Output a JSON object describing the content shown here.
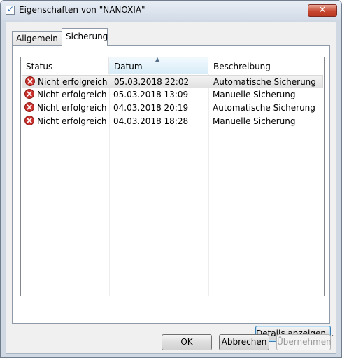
{
  "window": {
    "title": "Eigenschaften von \"NANOXIA\"",
    "close_label": "✕"
  },
  "tabs": [
    {
      "label": "Allgemein",
      "active": false
    },
    {
      "label": "Sicherung",
      "active": true
    }
  ],
  "list": {
    "columns": [
      "Status",
      "Datum",
      "Beschreibung"
    ],
    "sort_column": "Datum",
    "sort_direction": "ascending",
    "rows": [
      {
        "status": "Nicht erfolgreich",
        "status_icon": "error-icon",
        "datum": "05.03.2018 22:02",
        "beschreibung": "Automatische Sicherung",
        "selected": true
      },
      {
        "status": "Nicht erfolgreich",
        "status_icon": "error-icon",
        "datum": "05.03.2018 13:09",
        "beschreibung": "Manuelle Sicherung",
        "selected": false
      },
      {
        "status": "Nicht erfolgreich",
        "status_icon": "error-icon",
        "datum": "04.03.2018 20:19",
        "beschreibung": "Automatische Sicherung",
        "selected": false
      },
      {
        "status": "Nicht erfolgreich",
        "status_icon": "error-icon",
        "datum": "04.03.2018 18:28",
        "beschreibung": "Manuelle Sicherung",
        "selected": false
      }
    ]
  },
  "buttons": {
    "details": "Details anzeigen...",
    "ok": "OK",
    "cancel": "Abbrechen",
    "apply": "Übernehmen"
  },
  "colors": {
    "error": "#c9302c",
    "selection": "#e5e5e5",
    "sorted_header": "#d7ecf8"
  }
}
